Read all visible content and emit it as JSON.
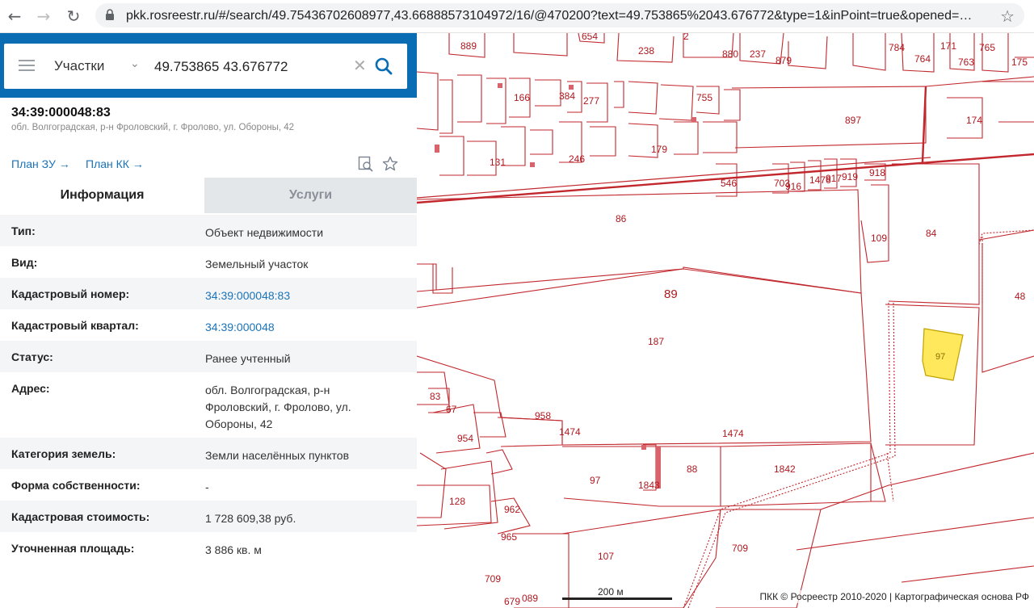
{
  "browser": {
    "url": "pkk.rosreestr.ru/#/search/49.75436702608977,43.66888573104972/16/@470200?text=49.753865%2043.676772&type=1&inPoint=true&opened=…",
    "back_icon": "←",
    "forward_icon": "→",
    "reload_icon": "↻",
    "star_icon": "☆"
  },
  "search": {
    "type_label": "Участки",
    "query": "49.753865 43.676772",
    "clear_icon": "✕",
    "collapse_icon": "‹"
  },
  "parcel": {
    "id": "34:39:000048:83",
    "address": "обл. Волгоградская, р-н Фроловский, г. Фролово, ул. Обороны, 42",
    "plan_zu": "План ЗУ →",
    "plan_kk": "План КК →"
  },
  "tabs": {
    "info": "Информация",
    "services": "Услуги"
  },
  "rows": [
    {
      "key": "Тип:",
      "value": "Объект недвижимости"
    },
    {
      "key": "Вид:",
      "value": "Земельный участок"
    },
    {
      "key": "Кадастровый номер:",
      "value": "34:39:000048:83"
    },
    {
      "key": "Кадастровый квартал:",
      "value": "34:39:000048"
    },
    {
      "key": "Статус:",
      "value": "Ранее учтенный"
    },
    {
      "key": "Адрес:",
      "value": "обл. Волгоградская, р-н Фроловский, г. Фролово, ул. Обороны, 42"
    },
    {
      "key": "Категория земель:",
      "value": "Земли населённых пунктов"
    },
    {
      "key": "Форма собственности:",
      "value": "-"
    },
    {
      "key": "Кадастровая стоимость:",
      "value": "1 728 609,38 руб."
    },
    {
      "key": "Уточненная площадь:",
      "value": "3 886 кв. м"
    }
  ],
  "map": {
    "parcel_labels": [
      "889",
      "654",
      "2",
      "238",
      "880",
      "237",
      "879",
      "784",
      "764",
      "171",
      "763",
      "765",
      "175",
      "166",
      "384",
      "277",
      "755",
      "897",
      "174",
      "131",
      "246",
      "179",
      "546",
      "703",
      "916",
      "1476",
      "917",
      "919",
      "918",
      "86",
      "84",
      "109",
      "89",
      "48",
      "187",
      "97",
      "83",
      "67",
      "954",
      "958",
      "1474",
      "1474",
      "97",
      "1843",
      "88",
      "1842",
      "128",
      "962",
      "965",
      "107",
      "709",
      "709",
      "679",
      "089"
    ],
    "scale_label": "200 м",
    "copyright": "ПКК © Росреестр 2010-2020 | Картографическая основа РФ"
  },
  "colors": {
    "accent": "#0a6db3",
    "link": "#1a73b8",
    "parcel_line": "#c1272d",
    "highlight": "#ffe85c"
  }
}
